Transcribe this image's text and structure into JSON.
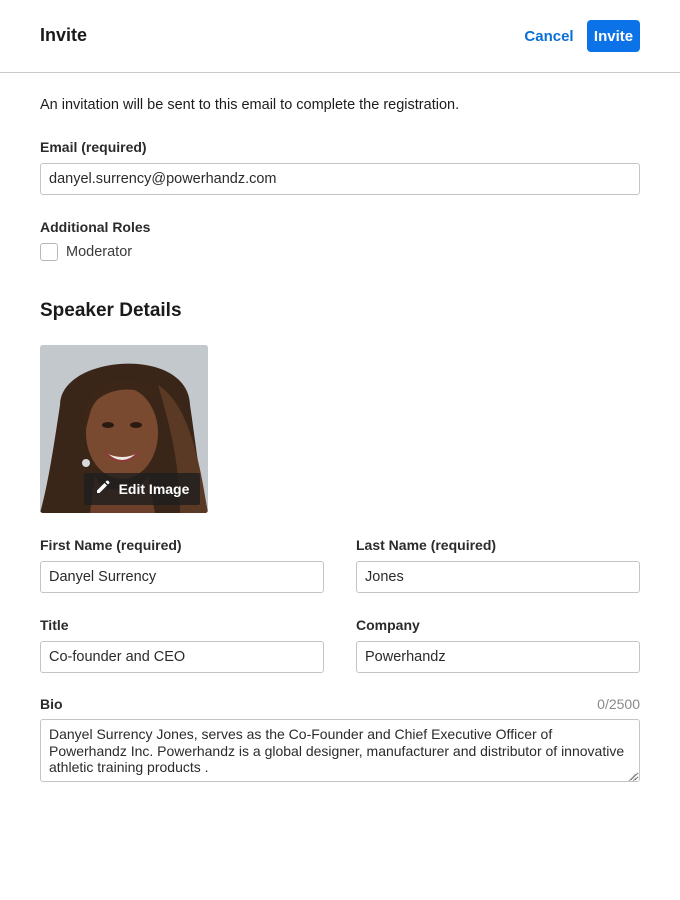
{
  "header": {
    "title": "Invite",
    "cancel_label": "Cancel",
    "invite_label": "Invite"
  },
  "intro_text": "An invitation will be sent to this email to complete the registration.",
  "email": {
    "label": "Email (required)",
    "value": "danyel.surrency@powerhandz.com"
  },
  "roles": {
    "label": "Additional Roles",
    "moderator_label": "Moderator",
    "moderator_checked": false
  },
  "speaker": {
    "section_title": "Speaker Details",
    "edit_image_label": "Edit Image",
    "first_name": {
      "label": "First Name (required)",
      "value": "Danyel Surrency"
    },
    "last_name": {
      "label": "Last Name (required)",
      "value": "Jones"
    },
    "title": {
      "label": "Title",
      "value": "Co-founder and CEO"
    },
    "company": {
      "label": "Company",
      "value": "Powerhandz"
    },
    "bio": {
      "label": "Bio",
      "counter": "0/2500",
      "value": "Danyel Surrency Jones, serves as the Co-Founder and Chief Executive Officer of Powerhandz Inc. Powerhandz is a global designer, manufacturer and distributor of innovative athletic training products ."
    }
  },
  "colors": {
    "accent": "#0b72e7",
    "link": "#0a6fd6",
    "border": "#c4c4c4"
  },
  "icons": {
    "edit": "pencil-icon",
    "resize": "resize-grip-icon"
  }
}
